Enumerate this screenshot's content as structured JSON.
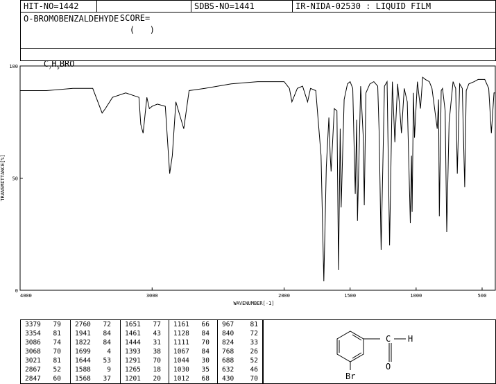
{
  "header": {
    "hit_no": "HIT-NO=1442",
    "score_label": "SCORE=",
    "score_value": "(   )",
    "sdbs_no": "SDBS-NO=1441",
    "ir_id": "IR-NIDA-02530 : LIQUID FILM"
  },
  "compound": {
    "name": "O-BROMOBENZALDEHYDE",
    "formula_c": "C",
    "formula_c_sub": "7",
    "formula_h": "H",
    "formula_h_sub": "5",
    "formula_rest": "BRO"
  },
  "chart_data": {
    "type": "line",
    "title": "",
    "xlabel": "WAVENUMBER[-1]",
    "ylabel": "TRANSMITTANCE[%]",
    "xlim": [
      4000,
      400
    ],
    "ylim": [
      0,
      100
    ],
    "x_ticks": [
      4000,
      3000,
      2000,
      1500,
      1000,
      500
    ],
    "x_tick_labels": [
      "4000",
      "3000",
      "2000",
      "1500",
      "1000",
      "500"
    ],
    "y_ticks": [
      0,
      50,
      100
    ],
    "y_tick_labels": [
      "0",
      "50",
      "100"
    ],
    "grid": false,
    "series": [
      {
        "x": [
          4000,
          3800,
          3600,
          3450,
          3379,
          3354,
          3300,
          3200,
          3100,
          3086,
          3068,
          3040,
          3021,
          3000,
          2960,
          2900,
          2867,
          2847,
          2820,
          2760,
          2720,
          2600,
          2400,
          2200,
          2100,
          2000,
          1960,
          1941,
          1900,
          1860,
          1822,
          1800,
          1760,
          1720,
          1699,
          1680,
          1661,
          1651,
          1644,
          1620,
          1600,
          1588,
          1575,
          1568,
          1545,
          1520,
          1500,
          1480,
          1461,
          1450,
          1444,
          1420,
          1400,
          1393,
          1380,
          1350,
          1320,
          1291,
          1280,
          1265,
          1240,
          1220,
          1201,
          1180,
          1161,
          1140,
          1128,
          1111,
          1090,
          1067,
          1044,
          1035,
          1030,
          1020,
          1012,
          990,
          967,
          950,
          930,
          900,
          880,
          840,
          830,
          824,
          810,
          800,
          780,
          768,
          750,
          720,
          700,
          688,
          670,
          650,
          632,
          620,
          600,
          560,
          530,
          480,
          450,
          430,
          410,
          400
        ],
        "y": [
          89,
          89,
          90,
          90,
          79,
          81,
          86,
          88,
          86,
          74,
          70,
          86,
          81,
          82,
          83,
          82,
          52,
          60,
          84,
          72,
          89,
          90,
          92,
          93,
          93,
          93,
          90,
          84,
          90,
          91,
          84,
          90,
          89,
          60,
          4,
          55,
          77,
          60,
          53,
          81,
          80,
          9,
          72,
          37,
          85,
          92,
          93,
          90,
          43,
          76,
          31,
          91,
          68,
          38,
          88,
          92,
          93,
          91,
          70,
          18,
          91,
          93,
          20,
          93,
          66,
          92,
          84,
          70,
          90,
          84,
          30,
          60,
          35,
          88,
          68,
          93,
          81,
          95,
          94,
          93,
          90,
          72,
          85,
          33,
          89,
          90,
          80,
          26,
          75,
          93,
          90,
          52,
          92,
          90,
          46,
          89,
          92,
          93,
          94,
          94,
          90,
          70,
          88,
          88
        ]
      }
    ]
  },
  "peak_table": {
    "columns": [
      [
        [
          "3379",
          "79"
        ],
        [
          "3354",
          "81"
        ],
        [
          "3086",
          "74"
        ],
        [
          "3068",
          "70"
        ],
        [
          "3021",
          "81"
        ],
        [
          "2867",
          "52"
        ],
        [
          "2847",
          "60"
        ]
      ],
      [
        [
          "2760",
          "72"
        ],
        [
          "1941",
          "84"
        ],
        [
          "1822",
          "84"
        ],
        [
          "1699",
          "4"
        ],
        [
          "1644",
          "53"
        ],
        [
          "1588",
          "9"
        ],
        [
          "1568",
          "37"
        ]
      ],
      [
        [
          "1651",
          "77"
        ],
        [
          "1461",
          "43"
        ],
        [
          "1444",
          "31"
        ],
        [
          "1393",
          "38"
        ],
        [
          "1291",
          "70"
        ],
        [
          "1265",
          "18"
        ],
        [
          "1201",
          "20"
        ]
      ],
      [
        [
          "1161",
          "66"
        ],
        [
          "1128",
          "84"
        ],
        [
          "1111",
          "70"
        ],
        [
          "1067",
          "84"
        ],
        [
          "1044",
          "30"
        ],
        [
          "1030",
          "35"
        ],
        [
          "1012",
          "68"
        ]
      ],
      [
        [
          "967",
          "81"
        ],
        [
          "840",
          "72"
        ],
        [
          "824",
          "33"
        ],
        [
          "768",
          "26"
        ],
        [
          "688",
          "52"
        ],
        [
          "632",
          "46"
        ],
        [
          "430",
          "70"
        ]
      ]
    ]
  },
  "structure": {
    "aldehyde_c": "C",
    "aldehyde_h": "H",
    "aldehyde_o": "O",
    "substituent": "Br"
  }
}
